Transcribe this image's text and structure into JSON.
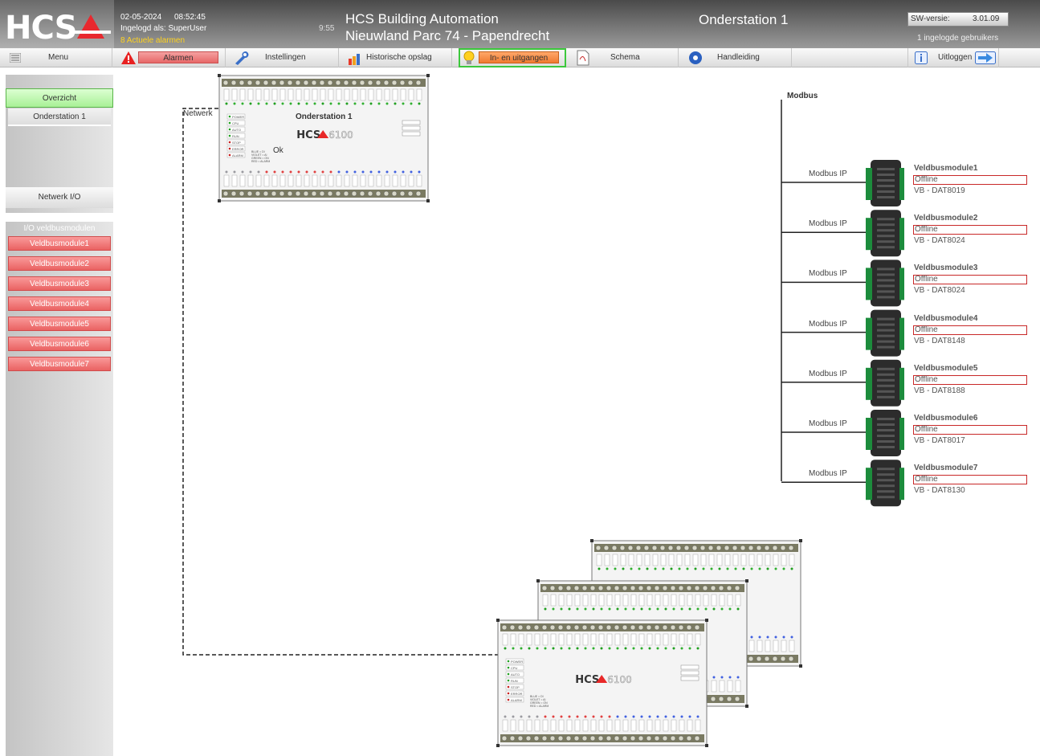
{
  "header": {
    "logo_text": "HCS",
    "date": "02-05-2024",
    "time": "08:52:45",
    "user_label": "Ingelogd als:  SuperUser",
    "alarms_text": "8 Actuele alarmen",
    "clock_small": "9:55",
    "title_line1": "HCS Building Automation",
    "title_line2": "Nieuwland Parc 74 - Papendrecht",
    "station": "Onderstation 1",
    "sw_label": "SW-versie:",
    "sw_version": "3.01.09",
    "logged_users": "1 ingelogde gebruikers"
  },
  "toolbar": {
    "menu": "Menu",
    "alarmen": "Alarmen",
    "instellingen": "Instellingen",
    "historische": "Historische opslag",
    "io": "In- en uitgangen",
    "schema": "Schema",
    "handleiding": "Handleiding",
    "uitloggen": "Uitloggen"
  },
  "sidebar": {
    "overzicht": "Overzicht",
    "onderstation": "Onderstation 1",
    "netwerk_io": "Netwerk I/O",
    "io_header": "I/O veldbusmodulen",
    "modules": [
      "Veldbusmodule1",
      "Veldbusmodule2",
      "Veldbusmodule3",
      "Veldbusmodule4",
      "Veldbusmodule5",
      "Veldbusmodule6",
      "Veldbusmodule7"
    ]
  },
  "diagram": {
    "netwerk_label": "Netwerk",
    "controller_title": "Onderstation 1",
    "controller_status": "Ok",
    "controller_brand": "HCS",
    "controller_model": "6100",
    "modbus_title": "Modbus",
    "modbus_ip_label": "Modbus IP",
    "modules": [
      {
        "name": "Veldbusmodule1",
        "status": "Offline",
        "type": "VB - DAT8019"
      },
      {
        "name": "Veldbusmodule2",
        "status": "Offline",
        "type": "VB - DAT8024"
      },
      {
        "name": "Veldbusmodule3",
        "status": "Offline",
        "type": "VB - DAT8024"
      },
      {
        "name": "Veldbusmodule4",
        "status": "Offline",
        "type": "VB - DAT8148"
      },
      {
        "name": "Veldbusmodule5",
        "status": "Offline",
        "type": "VB - DAT8188"
      },
      {
        "name": "Veldbusmodule6",
        "status": "Offline",
        "type": "VB - DAT8017"
      },
      {
        "name": "Veldbusmodule7",
        "status": "Offline",
        "type": "VB - DAT8130"
      }
    ],
    "controller_leds": [
      "POWER",
      "CPU",
      "AUTO",
      "RUN",
      "STOP",
      "ERROR",
      "ALARM"
    ],
    "legend": [
      "BLUE = DI",
      "VIOLET = AI",
      "GREEN = ON",
      "RED = ALARM"
    ]
  },
  "colors": {
    "accent_green": "#a8f096",
    "alarm_red": "#ea6262",
    "io_orange": "#f07a30",
    "alarms_yellow": "#ffd21e",
    "status_border": "#c82828"
  }
}
